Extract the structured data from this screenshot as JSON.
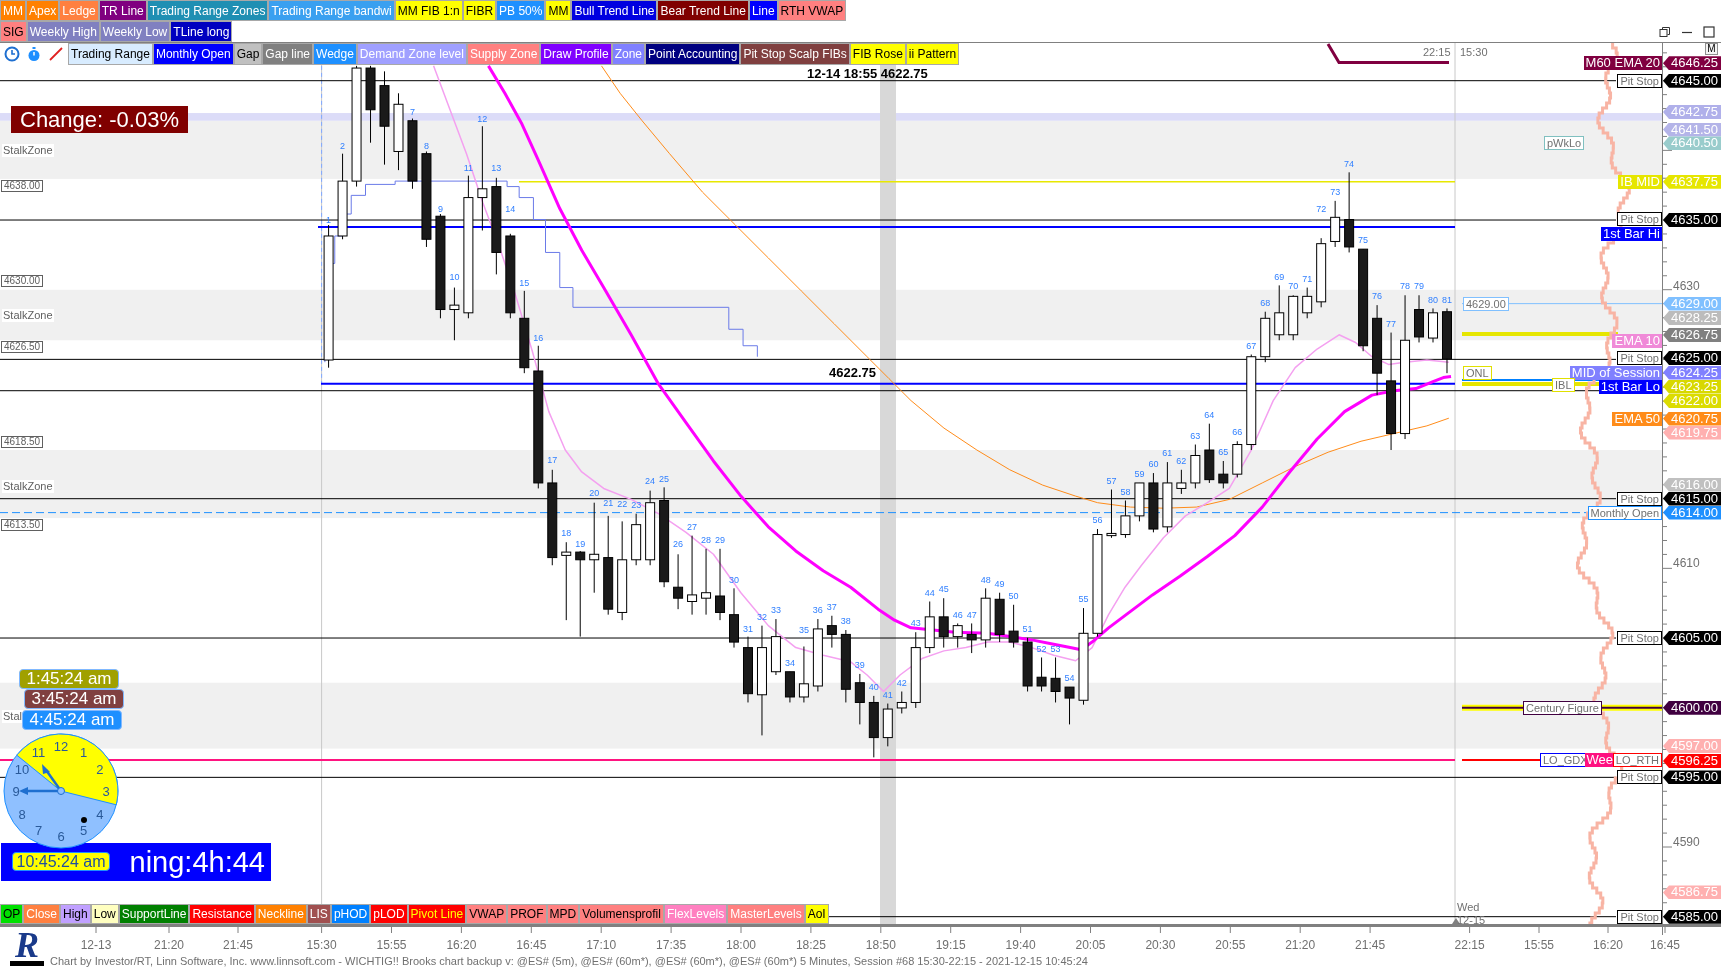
{
  "toolbar": [
    {
      "label": "MM",
      "color": "#ff8000",
      "kind": "light"
    },
    {
      "label": "Apex",
      "color": "#ff8000",
      "kind": "light"
    },
    {
      "label": "Ledge",
      "color": "#ff8040",
      "kind": "light"
    },
    {
      "label": "TR Line",
      "color": "#800080",
      "kind": "light"
    },
    {
      "label": "Trading Range Zones",
      "color": "#1f8fb3",
      "kind": "light"
    },
    {
      "label": "Trading Range bandwi",
      "color": "#3aa0f0",
      "kind": "light"
    },
    {
      "label": "MM FIB 1:n",
      "color": "#ffff00",
      "kind": "dark"
    },
    {
      "label": "FIBR",
      "color": "#ffff00",
      "kind": "dark"
    },
    {
      "label": "PB 50%",
      "color": "#1e90ff",
      "kind": "light"
    },
    {
      "label": "MM",
      "color": "#ffff00",
      "kind": "dark"
    },
    {
      "label": "Bull Trend Line",
      "color": "#0000e0",
      "kind": "light"
    },
    {
      "label": "Bear Trend Line",
      "color": "#800000",
      "kind": "light"
    },
    {
      "label": "Line",
      "color": "#0000ff",
      "kind": "light"
    },
    {
      "label": "RTH VWAP",
      "color": "#ff8080",
      "kind": "dark"
    }
  ],
  "toolbar_row_2": [
    {
      "label": "SIG",
      "color": "#ff8080",
      "kind": "dark"
    },
    {
      "label": "Weekly High",
      "color": "#8080c0",
      "kind": "light"
    },
    {
      "label": "Weekly Low",
      "color": "#8080c0",
      "kind": "light"
    },
    {
      "label": "TLine long",
      "color": "#0000c0",
      "kind": "light"
    }
  ],
  "drawing_toolbar": [
    {
      "label": "Trading Range",
      "color": "#d8ecff",
      "kind": "dark"
    },
    {
      "label": "Monthly Open",
      "color": "#0000ff",
      "kind": "light"
    },
    {
      "label": "Gap",
      "color": "#c0c0c0",
      "kind": "dark"
    },
    {
      "label": "Gap line",
      "color": "#808080",
      "kind": "light"
    },
    {
      "label": "Wedge",
      "color": "#1e90ff",
      "kind": "light"
    },
    {
      "label": "Demand Zone level",
      "color": "#a0a0ff",
      "kind": "light"
    },
    {
      "label": "Supply Zone",
      "color": "#ff8080",
      "kind": "light"
    },
    {
      "label": "Draw Profile",
      "color": "#8000ff",
      "kind": "light"
    },
    {
      "label": "Zone",
      "color": "#8080ff",
      "kind": "light"
    },
    {
      "label": "Point Accounting",
      "color": "#000080",
      "kind": "light"
    },
    {
      "label": "Pit Stop Scalp FIBs",
      "color": "#804040",
      "kind": "light"
    },
    {
      "label": "FIB Rose",
      "color": "#ffff00",
      "kind": "dark"
    },
    {
      "label": "ii Pattern",
      "color": "#ffff00",
      "kind": "dark"
    }
  ],
  "chart": {
    "cursor_readout": "12-14 18:55 4622.75",
    "session_times": [
      "22:15",
      "15:30"
    ],
    "mode_button": "M",
    "change_badge": "Change: -0.03%",
    "zone_labels": [
      "StalkZone",
      "StalkZone",
      "StalkZone",
      "Stal"
    ],
    "left_markers": [
      "4638.00",
      "4630.00",
      "4626.50",
      "4618.50",
      "4613.50"
    ],
    "bar_numbers": [
      "1",
      "2",
      "7",
      "8",
      "9",
      "10",
      "11",
      "12",
      "13",
      "14",
      "15",
      "16",
      "17",
      "18",
      "19",
      "20",
      "21",
      "22",
      "23",
      "24",
      "25",
      "26",
      "27",
      "28",
      "29",
      "30",
      "31",
      "32",
      "33",
      "34",
      "35",
      "36",
      "37",
      "38",
      "39",
      "40",
      "41",
      "42",
      "43",
      "44",
      "45",
      "46",
      "47",
      "48",
      "49",
      "50",
      "51",
      "52",
      "53",
      "54",
      "55",
      "56",
      "57",
      "58",
      "59",
      "60",
      "61",
      "62",
      "63",
      "64",
      "65",
      "66",
      "67",
      "68",
      "69",
      "70",
      "71",
      "72",
      "73",
      "74",
      "75",
      "76",
      "77",
      "78",
      "79",
      "80",
      "81"
    ],
    "level_labels": [
      {
        "text": "M60 EMA 20",
        "kind": "filled",
        "color": "#800040"
      },
      {
        "text": "Pit Stop",
        "kind": "boxed",
        "color": "#000000"
      },
      {
        "text": "pWkLo",
        "kind": "boxed",
        "color": "#80c0c0"
      },
      {
        "text": "IB MID",
        "kind": "filled",
        "color": "#e6e600"
      },
      {
        "text": "Pit Stop",
        "kind": "boxed",
        "color": "#000000"
      },
      {
        "text": "1st Bar Hi",
        "kind": "filled",
        "color": "#0000ff"
      },
      {
        "text": "4629.00",
        "kind": "boxed",
        "color": "#80c0ff"
      },
      {
        "text": "EMA 10",
        "kind": "filled",
        "color": "#f08ad8"
      },
      {
        "text": "Pit Stop",
        "kind": "boxed",
        "color": "#000000"
      },
      {
        "text": "4622.75",
        "kind": "plain",
        "color": "#000000"
      },
      {
        "text": "ONL",
        "kind": "boxed",
        "color": "#e0e000"
      },
      {
        "text": "MID of Session",
        "kind": "filled",
        "color": "#8080ff"
      },
      {
        "text": "IBL",
        "kind": "boxed",
        "color": "#e0e000"
      },
      {
        "text": "1st Bar Lo",
        "kind": "filled",
        "color": "#0000ff"
      },
      {
        "text": "EMA 50",
        "kind": "filled",
        "color": "#ff8c1a"
      },
      {
        "text": "Pit Stop",
        "kind": "boxed",
        "color": "#000000"
      },
      {
        "text": "Monthly Open",
        "kind": "boxed",
        "color": "#1e90ff"
      },
      {
        "text": "Pit Stop",
        "kind": "boxed",
        "color": "#000000"
      },
      {
        "text": "Century Figure",
        "kind": "boxed",
        "color": "#400040"
      },
      {
        "text": "LO_GDX",
        "kind": "boxed",
        "color": "#0000ff"
      },
      {
        "text": "Wee",
        "kind": "filled",
        "color": "#ff1080"
      },
      {
        "text": "LO_RTH",
        "kind": "boxed",
        "color": "#ff0000"
      },
      {
        "text": "Pit Stop",
        "kind": "boxed",
        "color": "#000000"
      },
      {
        "text": "Pit Stop",
        "kind": "boxed",
        "color": "#000000"
      }
    ],
    "price_tags": [
      {
        "text": "4646.25",
        "color": "#800040"
      },
      {
        "text": "4645.00",
        "color": "#000000"
      },
      {
        "text": "4642.75",
        "color": "#b0b0ea"
      },
      {
        "text": "4641.50",
        "color": "#b4b4e8"
      },
      {
        "text": "4640.50",
        "color": "#99cccc"
      },
      {
        "text": "4637.75",
        "color": "#e6e600"
      },
      {
        "text": "4635.00",
        "color": "#000000"
      },
      {
        "text": "4629.00",
        "color": "#80c0ff"
      },
      {
        "text": "4628.25",
        "color": "#bcbcbc"
      },
      {
        "text": "4626.75",
        "color": "#808080"
      },
      {
        "text": "4625.00",
        "color": "#000000"
      },
      {
        "text": "4624.25",
        "color": "#8080ff"
      },
      {
        "text": "4623.25",
        "color": "#d8d800"
      },
      {
        "text": "4622.00",
        "color": "#dcdc00"
      },
      {
        "text": "4620.75",
        "color": "#ff8c1a"
      },
      {
        "text": "4619.75",
        "color": "#ffb0b0"
      },
      {
        "text": "4616.00",
        "color": "#c0c0c0"
      },
      {
        "text": "4615.00",
        "color": "#000000"
      },
      {
        "text": "4614.00",
        "color": "#1e90ff"
      },
      {
        "text": "4605.00",
        "color": "#000000"
      },
      {
        "text": "4600.00",
        "color": "#400040"
      },
      {
        "text": "4597.00",
        "color": "#ffb0b0"
      },
      {
        "text": "4596.25",
        "color": "#ff0000"
      },
      {
        "text": "4595.00",
        "color": "#000000"
      },
      {
        "text": "4586.75",
        "color": "#ffb0b0"
      },
      {
        "text": "4585.00",
        "color": "#000000"
      }
    ],
    "axis_ticks": [
      "4630",
      "4610",
      "4590"
    ],
    "day_marker": [
      "Wed",
      "12-15"
    ]
  },
  "clocks": {
    "digital": [
      {
        "time": "1:45:24 am",
        "color": "#a0a000"
      },
      {
        "time": "3:45:24 am",
        "color": "#804040"
      },
      {
        "time": "4:45:24 am",
        "color": "#1e8fff"
      }
    ],
    "face_numbers": [
      "12",
      "11",
      "1",
      "10",
      "2",
      "9",
      "3",
      "8",
      "4",
      "7",
      "5",
      "6"
    ],
    "local_time": "10:45:24 am",
    "remaining": "ning:4h:44"
  },
  "bottom_toolbar": [
    {
      "label": "OP",
      "color": "#00e000",
      "kind": "dark"
    },
    {
      "label": "Close",
      "color": "#ff8040",
      "kind": "light"
    },
    {
      "label": "High",
      "color": "#c0a0ff",
      "kind": "dark"
    },
    {
      "label": "Low",
      "color": "#ffffc0",
      "kind": "dark"
    },
    {
      "label": "SupportLine",
      "color": "#008000",
      "kind": "light"
    },
    {
      "label": "Resistance",
      "color": "#ff0000",
      "kind": "light"
    },
    {
      "label": "Neckline",
      "color": "#ff8000",
      "kind": "light"
    },
    {
      "label": "LIS",
      "color": "#a05050",
      "kind": "light"
    },
    {
      "label": "pHOD",
      "color": "#0080ff",
      "kind": "light"
    },
    {
      "label": "pLOD",
      "color": "#ff0000",
      "kind": "light"
    },
    {
      "label": "Pivot Line",
      "color": "#ff0000",
      "kind": "highlight"
    },
    {
      "label": "VWAP",
      "color": "#ff8080",
      "kind": "dark"
    },
    {
      "label": "PROF",
      "color": "#ff8080",
      "kind": "dark"
    },
    {
      "label": "MPD",
      "color": "#ff8080",
      "kind": "dark"
    },
    {
      "label": "Volumensprofil",
      "color": "#ff8080",
      "kind": "dark"
    },
    {
      "label": "FlexLevels",
      "color": "#ff80c0",
      "kind": "light"
    },
    {
      "label": "MasterLevels",
      "color": "#ff8080",
      "kind": "light"
    },
    {
      "label": "AoI",
      "color": "#ffff00",
      "kind": "dark"
    }
  ],
  "time_axis": [
    "12-13",
    "21:20",
    "21:45",
    "15:30",
    "15:55",
    "16:20",
    "16:45",
    "17:10",
    "17:35",
    "18:00",
    "18:25",
    "18:50",
    "19:15",
    "19:40",
    "20:05",
    "20:30",
    "20:55",
    "21:20",
    "21:45",
    "22:15",
    "15:55",
    "16:20",
    "16:45"
  ],
  "footer": {
    "logo": "R",
    "text": "Chart by Investor/RT, Linn Software, Inc. www.linnsoft.com - WICHTIG!! Brooks chart backup v: @ES# (5m), @ES# (60m*), @ES# (60m*), @ES# (60m*) 5 Minutes, Session #68 15:30-22:15 - 2021-12-15 10:45:24"
  }
}
